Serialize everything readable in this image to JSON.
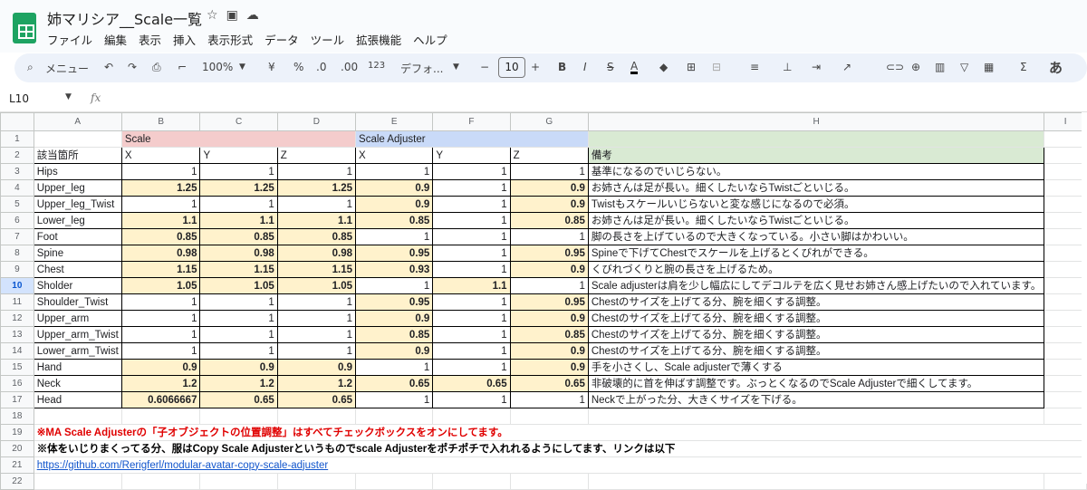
{
  "title": "姉マリシア__Scale一覧",
  "menu": [
    "ファイル",
    "編集",
    "表示",
    "挿入",
    "表示形式",
    "データ",
    "ツール",
    "拡張機能",
    "ヘルプ"
  ],
  "toolbar": {
    "search": "メニュー",
    "zoom": "100%",
    "currency": "¥",
    "percent": "%",
    "dec_less": ".0",
    "dec_more": ".00",
    "num_format": "123",
    "font": "デフォ...",
    "font_size": "10",
    "input_mode": "あ"
  },
  "namebox": "L10",
  "fx": "fx",
  "columns": [
    "A",
    "B",
    "C",
    "D",
    "E",
    "F",
    "G",
    "H",
    "I"
  ],
  "group_headers": {
    "scale": "Scale",
    "adjuster": "Scale Adjuster",
    "note": "備考"
  },
  "sub_headers": {
    "part": "該当箇所",
    "x": "X",
    "y": "Y",
    "z": "Z"
  },
  "rows": [
    {
      "part": "Hips",
      "sx": "1",
      "sy": "1",
      "sz": "1",
      "ax": "1",
      "ay": "1",
      "az": "1",
      "note": "基準になるのでいじらない。"
    },
    {
      "part": "Upper_leg",
      "sx": "1.25",
      "sy": "1.25",
      "sz": "1.25",
      "ax": "0.9",
      "ay": "1",
      "az": "0.9",
      "note": "お姉さんは足が長い。細くしたいならTwistごといじる。"
    },
    {
      "part": "Upper_leg_Twist",
      "sx": "1",
      "sy": "1",
      "sz": "1",
      "ax": "0.9",
      "ay": "1",
      "az": "0.9",
      "note": "Twistもスケールいじらないと変な感じになるので必須。"
    },
    {
      "part": "Lower_leg",
      "sx": "1.1",
      "sy": "1.1",
      "sz": "1.1",
      "ax": "0.85",
      "ay": "1",
      "az": "0.85",
      "note": "お姉さんは足が長い。細くしたいならTwistごといじる。"
    },
    {
      "part": "Foot",
      "sx": "0.85",
      "sy": "0.85",
      "sz": "0.85",
      "ax": "1",
      "ay": "1",
      "az": "1",
      "note": "脚の長さを上げているので大きくなっている。小さい脚はかわいい。"
    },
    {
      "part": "Spine",
      "sx": "0.98",
      "sy": "0.98",
      "sz": "0.98",
      "ax": "0.95",
      "ay": "1",
      "az": "0.95",
      "note": "Spineで下げてChestでスケールを上げるとくびれができる。"
    },
    {
      "part": "Chest",
      "sx": "1.15",
      "sy": "1.15",
      "sz": "1.15",
      "ax": "0.93",
      "ay": "1",
      "az": "0.9",
      "note": "くびれづくりと腕の長さを上げるため。"
    },
    {
      "part": "Sholder",
      "sx": "1.05",
      "sy": "1.05",
      "sz": "1.05",
      "ax": "1",
      "ay": "1.1",
      "az": "1",
      "note": "Scale adjusterは肩を少し幅広にしてデコルテを広く見せお姉さん感上げたいので入れています。"
    },
    {
      "part": "Shoulder_Twist",
      "sx": "1",
      "sy": "1",
      "sz": "1",
      "ax": "0.95",
      "ay": "1",
      "az": "0.95",
      "note": "Chestのサイズを上げてる分、腕を細くする調整。"
    },
    {
      "part": "Upper_arm",
      "sx": "1",
      "sy": "1",
      "sz": "1",
      "ax": "0.9",
      "ay": "1",
      "az": "0.9",
      "note": "Chestのサイズを上げてる分、腕を細くする調整。"
    },
    {
      "part": "Upper_arm_Twist",
      "sx": "1",
      "sy": "1",
      "sz": "1",
      "ax": "0.85",
      "ay": "1",
      "az": "0.85",
      "note": "Chestのサイズを上げてる分、腕を細くする調整。"
    },
    {
      "part": "Lower_arm_Twist",
      "sx": "1",
      "sy": "1",
      "sz": "1",
      "ax": "0.9",
      "ay": "1",
      "az": "0.9",
      "note": "Chestのサイズを上げてる分、腕を細くする調整。"
    },
    {
      "part": "Hand",
      "sx": "0.9",
      "sy": "0.9",
      "sz": "0.9",
      "ax": "1",
      "ay": "1",
      "az": "0.9",
      "note": "手を小さくし、Scale adjusterで薄くする"
    },
    {
      "part": "Neck",
      "sx": "1.2",
      "sy": "1.2",
      "sz": "1.2",
      "ax": "0.65",
      "ay": "0.65",
      "az": "0.65",
      "note": "非破壊的に首を伸ばす調整です。ぶっとくなるのでScale Adjusterで細くしてます。"
    },
    {
      "part": "Head",
      "sx": "0.6066667",
      "sy": "0.65",
      "sz": "0.65",
      "ax": "1",
      "ay": "1",
      "az": "1",
      "note": "Neckで上がった分、大きくサイズを下げる。"
    }
  ],
  "footer": {
    "line19": "※MA Scale Adjusterの「子オブジェクトの位置調整」はすべてチェックボックスをオンにしてます。",
    "line20": "※体をいじりまくってる分、服はCopy Scale Adjusterというものでscale Adjusterをポチポチで入れれるようにしてます、リンクは以下",
    "line21": "https://github.com/Rerigferl/modular-avatar-copy-scale-adjuster"
  },
  "row_numbers": [
    "1",
    "2",
    "3",
    "4",
    "5",
    "6",
    "7",
    "8",
    "9",
    "10",
    "11",
    "12",
    "13",
    "14",
    "15",
    "16",
    "17",
    "18",
    "19",
    "20",
    "21",
    "22"
  ],
  "selected_row": "10",
  "colors": {
    "scale_header": "#f4cccc",
    "adjuster_header": "#c9daf8",
    "note_header": "#d9ead3",
    "changed_cell": "#fff2cc",
    "warning_text": "#e00000",
    "link": "#1155cc"
  }
}
